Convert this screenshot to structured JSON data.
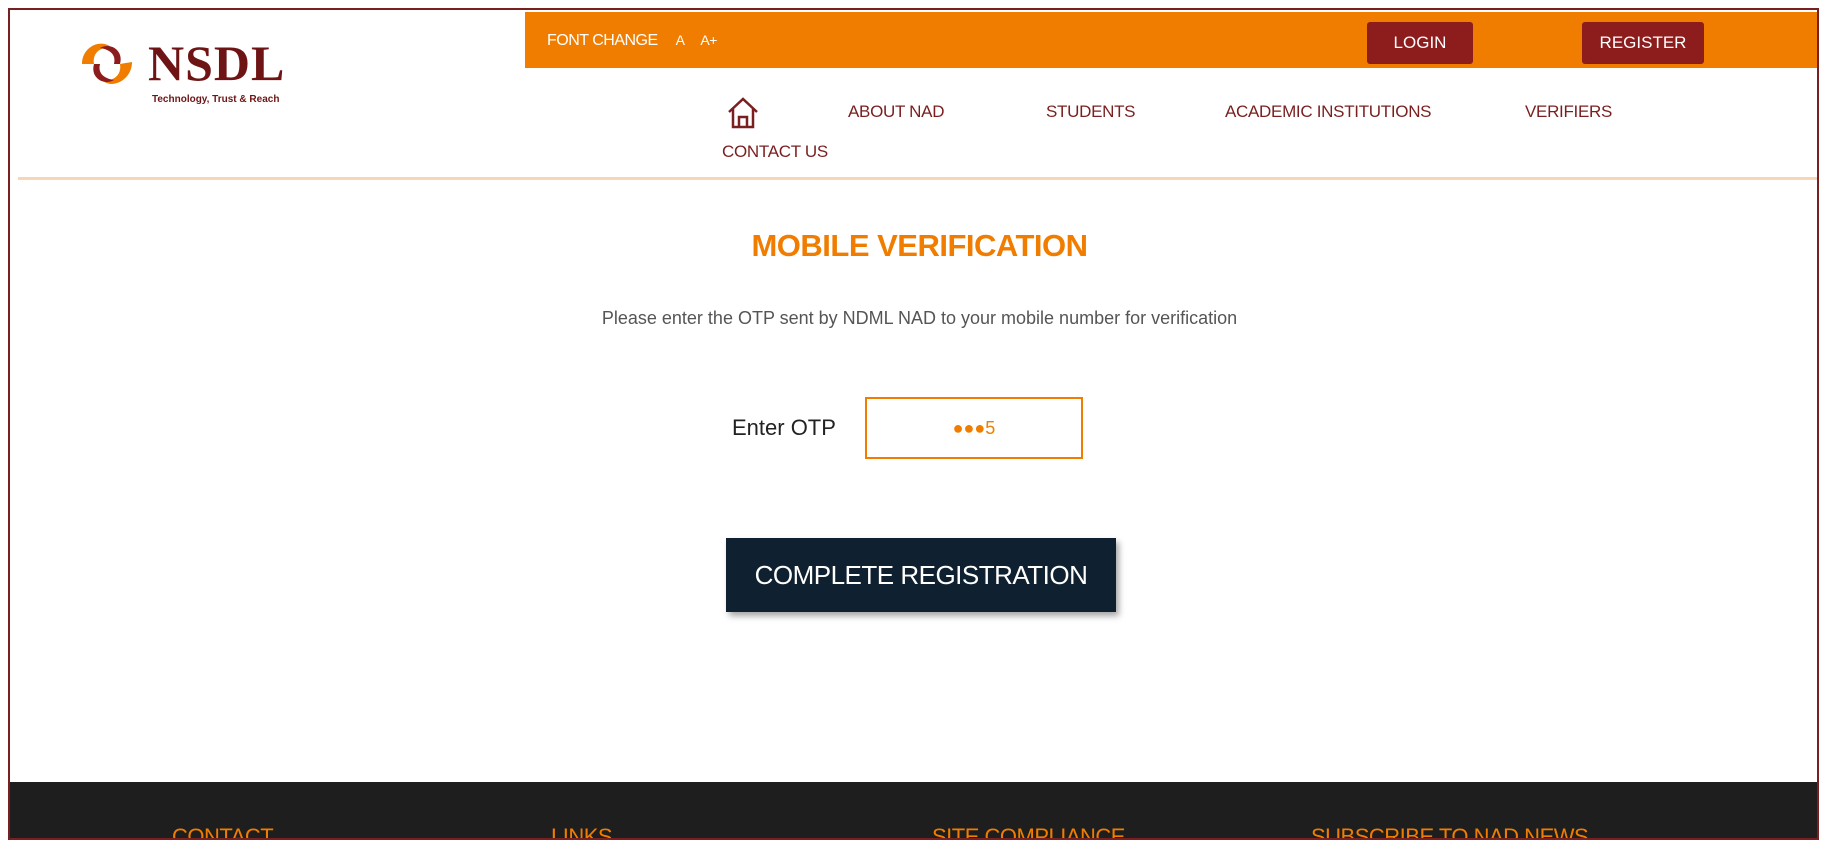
{
  "brand": {
    "name": "NSDL",
    "tagline": "Technology, Trust & Reach",
    "primary_color": "#f07d00",
    "secondary_color": "#8d1c1c",
    "dark_color": "#0f2030"
  },
  "topbar": {
    "font_change_label": "FONT CHANGE",
    "font_small_label": "A",
    "font_large_label": "A+",
    "login_label": "LOGIN",
    "register_label": "REGISTER"
  },
  "nav": {
    "home_icon": "home-icon",
    "items": [
      {
        "label": "ABOUT NAD"
      },
      {
        "label": "STUDENTS"
      },
      {
        "label": "ACADEMIC INSTITUTIONS"
      },
      {
        "label": "VERIFIERS"
      },
      {
        "label": "CONTACT US"
      }
    ]
  },
  "main": {
    "title": "MOBILE VERIFICATION",
    "instruction": "Please enter the OTP sent by NDML NAD to your mobile number for verification",
    "otp_label": "Enter OTP",
    "otp_value": "●●●5",
    "submit_label": "COMPLETE REGISTRATION"
  },
  "footer": {
    "columns": [
      {
        "label": "CONTACT"
      },
      {
        "label": "LINKS"
      },
      {
        "label": "SITE COMPLIANCE"
      },
      {
        "label": "SUBSCRIBE TO NAD NEWS"
      }
    ]
  }
}
